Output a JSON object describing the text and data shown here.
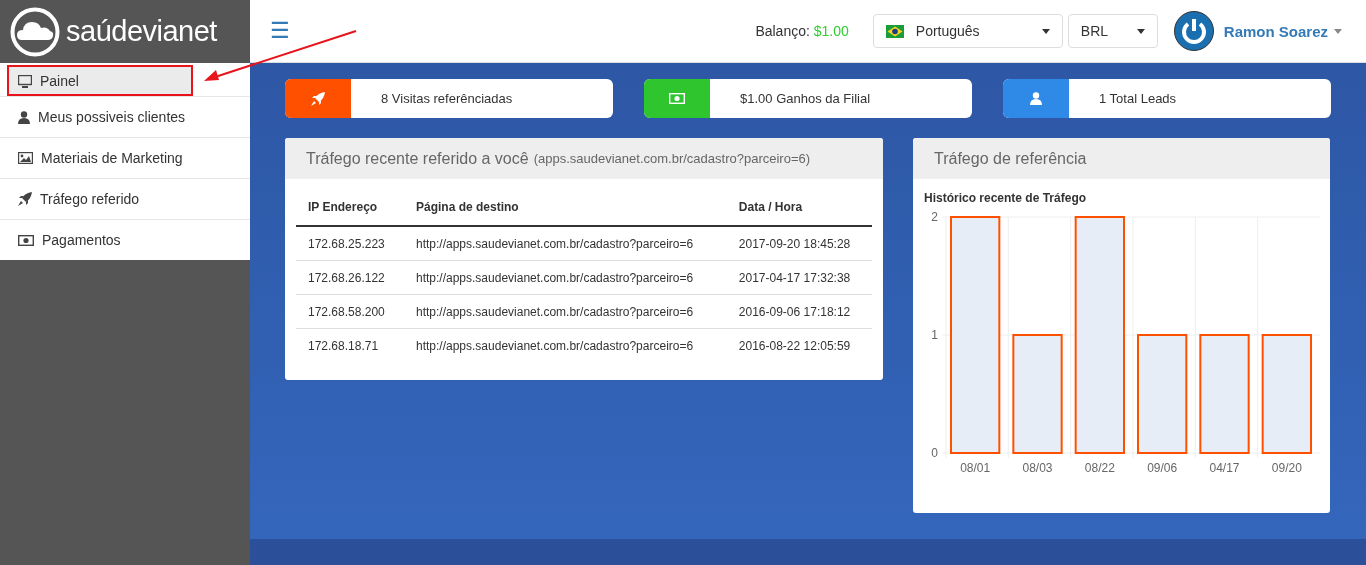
{
  "brand": {
    "name": "saúdevianet"
  },
  "sidebar": {
    "items": [
      {
        "label": "Painel",
        "kind": "monitor",
        "selected": true,
        "annotated": true
      },
      {
        "label": "Meus possiveis clientes",
        "kind": "user",
        "selected": false,
        "annotated": false
      },
      {
        "label": "Materiais de Marketing",
        "kind": "image",
        "selected": false,
        "annotated": false
      },
      {
        "label": "Tráfego referido",
        "kind": "rocket",
        "selected": false,
        "annotated": false
      },
      {
        "label": "Pagamentos",
        "kind": "money",
        "selected": false,
        "annotated": false
      }
    ]
  },
  "topbar": {
    "menu_icon": "☰",
    "balance_label": "Balanço:",
    "balance_value": "$1.00",
    "language": "Português",
    "currency": "BRL",
    "user": "Ramon Soarez"
  },
  "stats": [
    {
      "kind": "rocket",
      "color": "#ff5000",
      "text": "8 Visitas referênciadas"
    },
    {
      "kind": "money",
      "color": "#2ec52e",
      "text": "$1.00 Ganhos da Filial"
    },
    {
      "kind": "user",
      "color": "#2e8ae6",
      "text": "1 Total Leads"
    }
  ],
  "traffic_table": {
    "title": "Tráfego recente referido a você",
    "subtitle": "(apps.saudevianet.com.br/cadastro?parceiro=6)",
    "columns": [
      "IP Endereço",
      "Página de destino",
      "Data / Hora"
    ],
    "rows": [
      [
        "172.68.25.223",
        "http://apps.saudevianet.com.br/cadastro?parceiro=6",
        "2017-09-20 18:45:28"
      ],
      [
        "172.68.26.122",
        "http://apps.saudevianet.com.br/cadastro?parceiro=6",
        "2017-04-17 17:32:38"
      ],
      [
        "172.68.58.200",
        "http://apps.saudevianet.com.br/cadastro?parceiro=6",
        "2016-09-06 17:18:12"
      ],
      [
        "172.68.18.71",
        "http://apps.saudevianet.com.br/cadastro?parceiro=6",
        "2016-08-22 12:05:59"
      ]
    ]
  },
  "referral_panel": {
    "title": "Tráfego de referência",
    "chart_data": {
      "type": "bar",
      "title": "Histórico recente de Tráfego",
      "categories": [
        "08/01",
        "08/03",
        "08/22",
        "09/06",
        "04/17",
        "09/20"
      ],
      "series": [
        {
          "color": "#ff5000",
          "values": [
            2,
            1,
            2,
            1,
            1,
            1
          ]
        }
      ],
      "ylim": [
        0,
        2
      ],
      "yticks": [
        0,
        1,
        2
      ]
    }
  }
}
